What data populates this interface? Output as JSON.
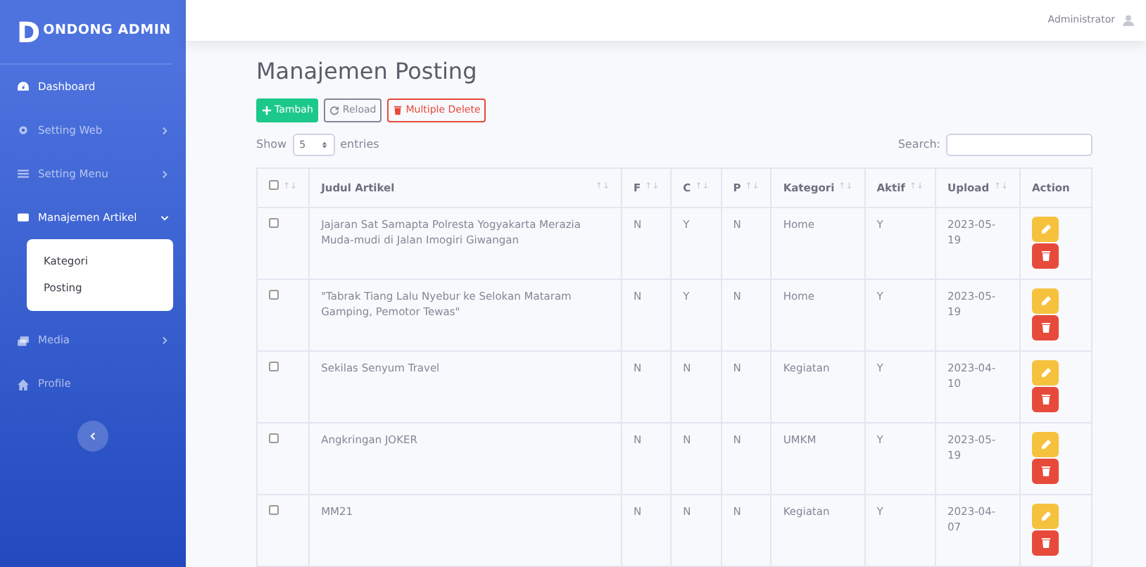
{
  "brand": {
    "letter": "D",
    "name": "ONDONG ADMIN"
  },
  "topbar": {
    "user": "Administrator"
  },
  "sidebar": {
    "items": [
      {
        "label": "Dashboard",
        "active": true
      },
      {
        "label": "Setting Web",
        "active": false,
        "expanded": false
      },
      {
        "label": "Setting Menu",
        "active": false,
        "expanded": false
      },
      {
        "label": "Manajemen Artikel",
        "active": true,
        "expanded": true,
        "children": [
          {
            "label": "Kategori"
          },
          {
            "label": "Posting"
          }
        ]
      },
      {
        "label": "Media",
        "active": false,
        "expanded": false
      },
      {
        "label": "Profile",
        "active": false
      }
    ]
  },
  "page": {
    "title": "Manajemen Posting"
  },
  "toolbar": [
    {
      "kind": "add",
      "label": "Tambah"
    },
    {
      "kind": "reload",
      "label": "Reload"
    },
    {
      "kind": "delete",
      "label": "Multiple Delete"
    }
  ],
  "length": {
    "before": "Show",
    "value": "5",
    "after": "entries"
  },
  "search": {
    "label": "Search:"
  },
  "table": {
    "select_all": {
      "checked": false,
      "sort": "↑↓"
    },
    "columns": [
      {
        "label": "Judul Artikel",
        "sort": "↑↓"
      },
      {
        "label": "F",
        "sort": "↑↓"
      },
      {
        "label": "C",
        "sort": "↑↓"
      },
      {
        "label": "P",
        "sort": "↑↓"
      },
      {
        "label": "Kategori",
        "sort": "↑↓"
      },
      {
        "label": "Aktif",
        "sort": "↑↓"
      },
      {
        "label": "Upload",
        "sort": "↑↓"
      },
      {
        "label": "Action"
      }
    ],
    "rows": [
      {
        "checked": false,
        "cells": [
          "Jajaran Sat Samapta Polresta Yogyakarta Merazia Muda-mudi di Jalan Imogiri Giwangan",
          "N",
          "Y",
          "N",
          "Home",
          "Y",
          "2023-05-19"
        ]
      },
      {
        "checked": false,
        "cells": [
          "\"Tabrak Tiang Lalu Nyebur ke Selokan Mataram Gamping, Pemotor Tewas\"",
          "N",
          "Y",
          "N",
          "Home",
          "Y",
          "2023-05-19"
        ]
      },
      {
        "checked": false,
        "cells": [
          "Sekilas Senyum Travel",
          "N",
          "N",
          "N",
          "Kegiatan",
          "Y",
          "2023-04-10"
        ]
      },
      {
        "checked": false,
        "cells": [
          "Angkringan JOKER",
          "N",
          "N",
          "N",
          "UMKM",
          "Y",
          "2023-05-19"
        ]
      },
      {
        "checked": false,
        "cells": [
          "MM21",
          "N",
          "N",
          "N",
          "Kegiatan",
          "Y",
          "2023-04-07"
        ]
      }
    ]
  }
}
